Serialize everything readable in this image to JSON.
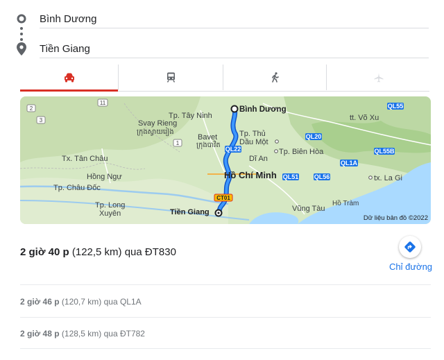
{
  "origin": {
    "value": "Bình Dương"
  },
  "destination": {
    "value": "Tiền Giang"
  },
  "tabs": [
    {
      "name": "car-icon",
      "selected": true
    },
    {
      "name": "transit-icon",
      "selected": false
    },
    {
      "name": "walking-icon",
      "selected": false
    },
    {
      "name": "flight-icon",
      "selected": false
    }
  ],
  "map": {
    "labels": {
      "binh_duong": "Bình Dương",
      "tay_ninh": "Tp. Tây Ninh",
      "svay_rieng": "Svay Rieng",
      "svay_rieng_km": "ក្រុងស្វាយរៀង",
      "bavet": "Bavet",
      "bavet_km": "ក្រុងបាវិត",
      "thu_dau_mot": "Tp. Thủ\nDầu Một",
      "bien_hoa": "Tp. Biên Hòa",
      "vo_xu": "tt. Võ Xu",
      "tan_chau": "Tx. Tân Châu",
      "hong_ngu": "Hồng Ngự",
      "di_an": "Dĩ An",
      "ho_chi_minh": "Hồ Chí Minh",
      "la_gi": "tx. La Gi",
      "chau_doc": "Tp. Châu Đốc",
      "long_xuyen": "Tp. Long\nXuyên",
      "tien_giang": "Tiền Giang",
      "vung_tau": "Vũng Tàu",
      "ho_tram": "Hồ Tràm",
      "attribution": "Dữ liệu bản đồ ©2022"
    },
    "shields": {
      "ql55": "QL55",
      "ql20": "QL20",
      "ql22": "QL22",
      "ql1a": "QL1A",
      "ql55b": "QL55B",
      "ql51": "QL51",
      "ql56": "QL56",
      "ct01": "CT01",
      "s11": "11",
      "s3": "3",
      "s2": "2",
      "s1": "1"
    }
  },
  "main_route": {
    "duration": "2 giờ 40 p",
    "detail": "(122,5 km) qua ĐT830"
  },
  "directions_label": "Chỉ đường",
  "alternatives": [
    {
      "duration": "2 giờ 46 p",
      "detail": "(120,7 km) qua QL1A"
    },
    {
      "duration": "2 giờ 48 p",
      "detail": "(128,5 km) qua ĐT782"
    }
  ]
}
